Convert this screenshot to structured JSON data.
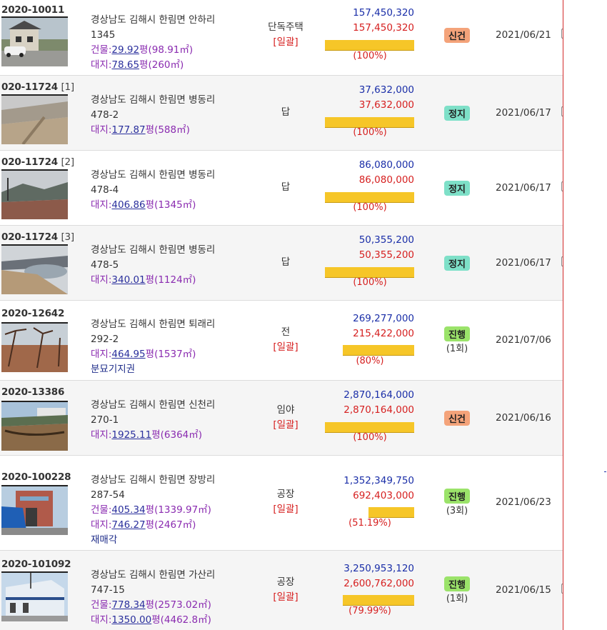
{
  "rows": [
    {
      "case_no": "2020-10011",
      "case_sub": "",
      "address": "경상남도 김해시 한림면 안하리",
      "lot": "1345",
      "bldg_label": "건물:",
      "bldg_area": "29.92",
      "bldg_unit": "평",
      "bldg_m2": "(98.91㎡)",
      "land_label": "대지:",
      "land_area": "78.65",
      "land_unit": "평",
      "land_m2": "(260㎡)",
      "note": "",
      "usage": "단독주택",
      "bundle": "[일괄]",
      "appraisal": "157,450,320",
      "minimum": "157,450,320",
      "ratio": "(100%)",
      "ratio_value": 100,
      "status": "신건",
      "status_type": "new",
      "rounds": "",
      "date": "2021/06/21"
    },
    {
      "case_no": "020-11724",
      "case_sub": "[1]",
      "address": "경상남도 김해시 한림면 병동리",
      "lot": "478-2",
      "bldg_label": "",
      "bldg_area": "",
      "bldg_unit": "",
      "bldg_m2": "",
      "land_label": "대지:",
      "land_area": "177.87",
      "land_unit": "평",
      "land_m2": "(588㎡)",
      "note": "",
      "usage": "답",
      "bundle": "",
      "appraisal": "37,632,000",
      "minimum": "37,632,000",
      "ratio": "(100%)",
      "ratio_value": 100,
      "status": "정지",
      "status_type": "stop",
      "rounds": "",
      "date": "2021/06/17"
    },
    {
      "case_no": "020-11724",
      "case_sub": "[2]",
      "address": "경상남도 김해시 한림면 병동리",
      "lot": "478-4",
      "bldg_label": "",
      "bldg_area": "",
      "bldg_unit": "",
      "bldg_m2": "",
      "land_label": "대지:",
      "land_area": "406.86",
      "land_unit": "평",
      "land_m2": "(1345㎡)",
      "note": "",
      "usage": "답",
      "bundle": "",
      "appraisal": "86,080,000",
      "minimum": "86,080,000",
      "ratio": "(100%)",
      "ratio_value": 100,
      "status": "정지",
      "status_type": "stop",
      "rounds": "",
      "date": "2021/06/17"
    },
    {
      "case_no": "020-11724",
      "case_sub": "[3]",
      "address": "경상남도 김해시 한림면 병동리",
      "lot": "478-5",
      "bldg_label": "",
      "bldg_area": "",
      "bldg_unit": "",
      "bldg_m2": "",
      "land_label": "대지:",
      "land_area": "340.01",
      "land_unit": "평",
      "land_m2": "(1124㎡)",
      "note": "",
      "usage": "답",
      "bundle": "",
      "appraisal": "50,355,200",
      "minimum": "50,355,200",
      "ratio": "(100%)",
      "ratio_value": 100,
      "status": "정지",
      "status_type": "stop",
      "rounds": "",
      "date": "2021/06/17"
    },
    {
      "case_no": "2020-12642",
      "case_sub": "",
      "address": "경상남도 김해시 한림면 퇴래리",
      "lot": "292-2",
      "bldg_label": "",
      "bldg_area": "",
      "bldg_unit": "",
      "bldg_m2": "",
      "land_label": "대지:",
      "land_area": "464.95",
      "land_unit": "평",
      "land_m2": "(1537㎡)",
      "note": "분묘기지권",
      "usage": "전",
      "bundle": "[일괄]",
      "appraisal": "269,277,000",
      "minimum": "215,422,000",
      "ratio": "(80%)",
      "ratio_value": 80,
      "status": "진행",
      "status_type": "prog",
      "rounds": "(1회)",
      "date": "2021/07/06"
    },
    {
      "case_no": "2020-13386",
      "case_sub": "",
      "address": "경상남도 김해시 한림면 신천리",
      "lot": "270-1",
      "bldg_label": "",
      "bldg_area": "",
      "bldg_unit": "",
      "bldg_m2": "",
      "land_label": "대지:",
      "land_area": "1925.11",
      "land_unit": "평",
      "land_m2": "(6364㎡)",
      "note": "",
      "usage": "임야",
      "bundle": "[일괄]",
      "appraisal": "2,870,164,000",
      "minimum": "2,870,164,000",
      "ratio": "(100%)",
      "ratio_value": 100,
      "status": "신건",
      "status_type": "new",
      "rounds": "",
      "date": "2021/06/16"
    },
    {
      "case_no": "2020-100228",
      "case_sub": "",
      "address": "경상남도 김해시 한림면 장방리",
      "lot": "287-54",
      "bldg_label": "건물:",
      "bldg_area": "405.34",
      "bldg_unit": "평",
      "bldg_m2": "(1339.97㎡)",
      "land_label": "대지:",
      "land_area": "746.27",
      "land_unit": "평",
      "land_m2": "(2467㎡)",
      "note": "재매각",
      "usage": "공장",
      "bundle": "[일괄]",
      "appraisal": "1,352,349,750",
      "minimum": "692,403,000",
      "ratio": "(51.19%)",
      "ratio_value": 51.19,
      "status": "진행",
      "status_type": "prog",
      "rounds": "(3회)",
      "date": "2021/06/23"
    },
    {
      "case_no": "2020-101092",
      "case_sub": "",
      "address": "경상남도 김해시 한림면 가산리",
      "lot": "747-15",
      "bldg_label": "건물:",
      "bldg_area": "778.34",
      "bldg_unit": "평",
      "bldg_m2": "(2573.02㎡)",
      "land_label": "대지:",
      "land_area": "1350.00",
      "land_unit": "평",
      "land_m2": "(4462.8㎡)",
      "note": "",
      "usage": "공장",
      "bundle": "[일괄]",
      "appraisal": "3,250,953,120",
      "minimum": "2,600,762,000",
      "ratio": "(79.99%)",
      "ratio_value": 79.99,
      "status": "진행",
      "status_type": "prog",
      "rounds": "(1회)",
      "date": "2021/06/15"
    }
  ]
}
